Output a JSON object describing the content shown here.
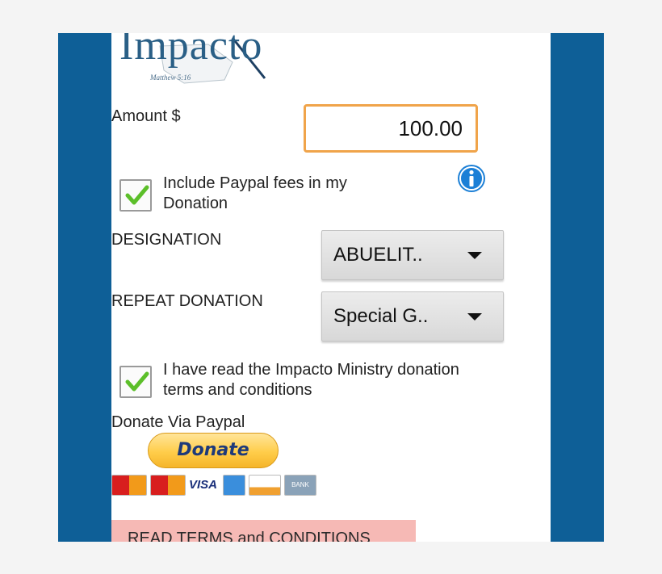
{
  "logo": {
    "word": "Impacto",
    "verse": "Matthew 5:16"
  },
  "amount": {
    "label": "Amount $",
    "value": "100.00"
  },
  "include_fees": {
    "label_line1": "Include Paypal fees in my",
    "label_line2": "Donation",
    "checked": true
  },
  "designation": {
    "label": "DESIGNATION",
    "value": "ABUELIT.."
  },
  "repeat_donation": {
    "label": "REPEAT DONATION",
    "value": "Special G.."
  },
  "terms_agree": {
    "label_line1": "I have read the Impacto Ministry donation",
    "label_line2": "terms and conditions",
    "checked": true
  },
  "paypal": {
    "label": "Donate Via Paypal",
    "button_label": "Donate",
    "cards": {
      "visa": "VISA",
      "bank": "BANK"
    }
  },
  "terms_button": {
    "label": "READ TERMS and CONDITIONS"
  },
  "colors": {
    "frame": "#0e5f97",
    "input_border": "#f0a44a",
    "checkmark": "#5cbf2a",
    "info_icon": "#1b7fd6",
    "terms_bar": "#f6b9b5"
  }
}
